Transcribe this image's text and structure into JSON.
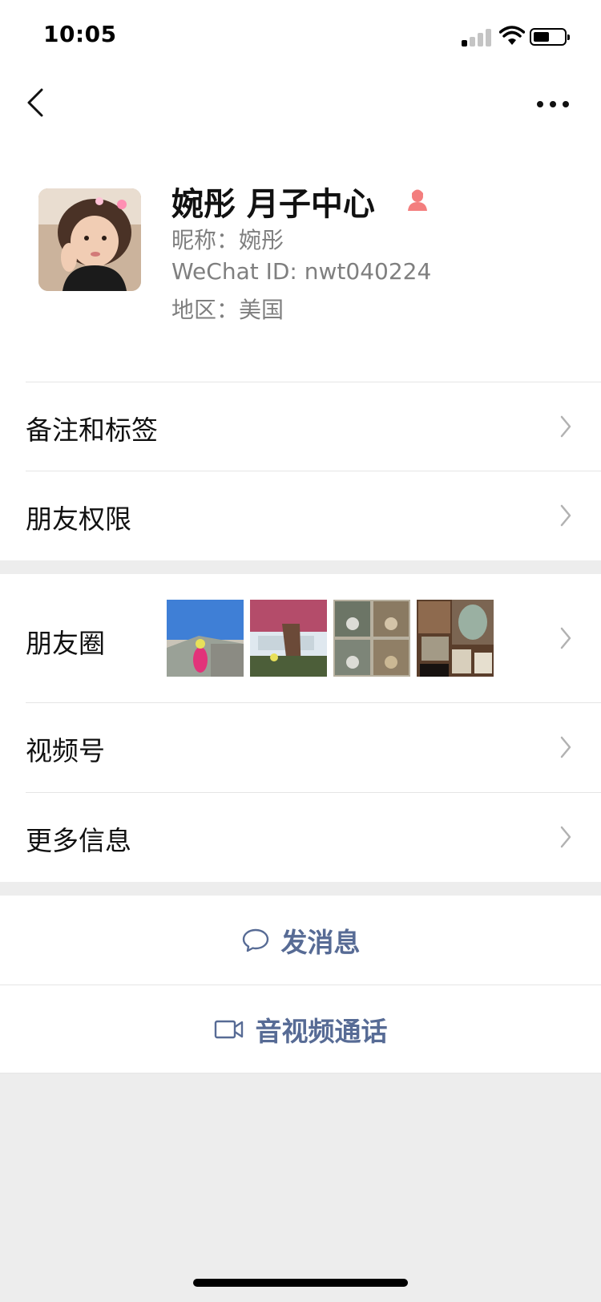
{
  "status_bar": {
    "time": "10:05",
    "icons": [
      "signal-icon",
      "wifi-icon",
      "battery-icon"
    ]
  },
  "nav": {
    "back_icon": "chevron-left-icon",
    "more_icon": "more-dots-icon"
  },
  "profile": {
    "name": "婉彤 月子中心",
    "gender_icon": "female-icon",
    "gender_color": "#f37e7e",
    "nickname": "昵称：婉彤",
    "wechat_id": "WeChat ID: nwt040224",
    "region": "地区：美国"
  },
  "menu": {
    "remarks_tags": "备注和标签",
    "friend_permissions": "朋友权限",
    "moments": "朋友圈",
    "channels": "视频号",
    "more_info": "更多信息"
  },
  "actions": {
    "message": "发消息",
    "video_call": "音视频通话"
  },
  "colors": {
    "link": "#576b95",
    "background": "#ededed",
    "divider": "#e5e5e5"
  }
}
